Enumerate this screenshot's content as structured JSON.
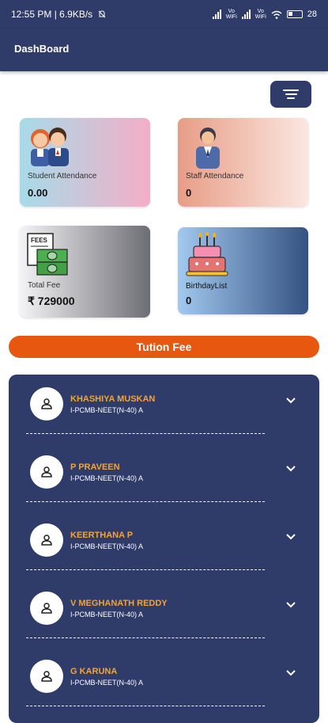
{
  "status_bar": {
    "time_speed": "12:55 PM | 6.9KB/s",
    "volte_1": "Vo\nWiFi",
    "volte_2": "Vo\nWiFi",
    "battery": "28"
  },
  "app_bar": {
    "title": "DashBoard"
  },
  "filter_button": {
    "icon": "sort-lines-icon"
  },
  "cards": {
    "student_attendance": {
      "label": "Student Attendance",
      "value": "0.00",
      "icon": "students-icon"
    },
    "staff_attendance": {
      "label": "Staff Attendance",
      "value": "0",
      "icon": "staff-icon"
    },
    "total_fee": {
      "label": "Total Fee",
      "value": "₹ 729000",
      "icon": "fees-money-icon",
      "icon_text": "FEES"
    },
    "birthday_list": {
      "label": "BirthdayList",
      "value": "0",
      "icon": "birthday-cake-icon"
    }
  },
  "tution_fee": {
    "label": "Tution Fee",
    "color": "#e8570f"
  },
  "students": [
    {
      "name": "KHASHIYA MUSKAN",
      "class": "I-PCMB-NEET(N-40) A"
    },
    {
      "name": "P PRAVEEN",
      "class": "I-PCMB-NEET(N-40) A"
    },
    {
      "name": "KEERTHANA P",
      "class": "I-PCMB-NEET(N-40) A"
    },
    {
      "name": "V MEGHANATH REDDY",
      "class": "I-PCMB-NEET(N-40) A"
    },
    {
      "name": "G KARUNA",
      "class": "I-PCMB-NEET(N-40) A"
    }
  ],
  "colors": {
    "primary": "#2f3c6a",
    "accent_name": "#f2a33a"
  }
}
